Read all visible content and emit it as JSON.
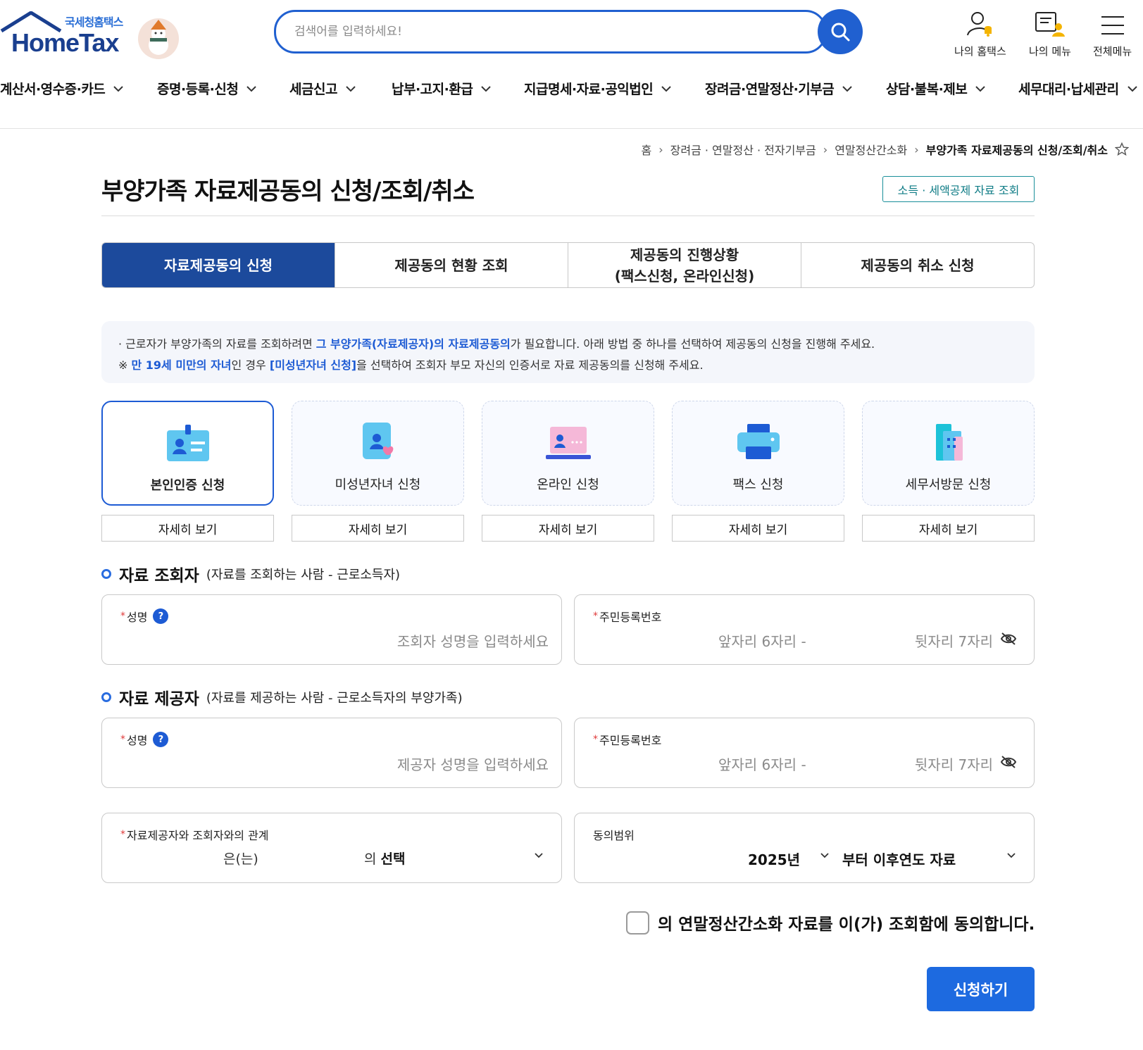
{
  "logo": {
    "sub": "국세청홈택스",
    "main": "HomeTax"
  },
  "search": {
    "placeholder": "검색어를 입력하세요!"
  },
  "util": {
    "my_hometax": "나의 홈택스",
    "my_menu": "나의 메뉴",
    "all_menu": "전체메뉴"
  },
  "gnb": [
    "계산서·영수증·카드",
    "증명·등록·신청",
    "세금신고",
    "납부·고지·환급",
    "지급명세·자료·공익법인",
    "장려금·연말정산·기부금",
    "상담·불복·제보",
    "세무대리·납세관리"
  ],
  "breadcrumb": {
    "home": "홈",
    "l1": "장려금 · 연말정산 · 전자기부금",
    "l2": "연말정산간소화",
    "current": "부양가족 자료제공동의 신청/조회/취소"
  },
  "page_title": "부양가족 자료제공동의 신청/조회/취소",
  "link_button": "소득 · 세액공제 자료 조회",
  "tabs": [
    {
      "line1": "자료제공동의 신청",
      "line2": ""
    },
    {
      "line1": "제공동의 현황 조회",
      "line2": ""
    },
    {
      "line1": "제공동의 진행상황",
      "line2": "(팩스신청, 온라인신청)"
    },
    {
      "line1": "제공동의 취소 신청",
      "line2": ""
    }
  ],
  "info": {
    "p1_a": "· 근로자가 부양가족의 자료를 조회하려면 ",
    "p1_hl": "그 부양가족(자료제공자)의 자료제공동의",
    "p1_b": "가 필요합니다. 아래 방법 중 하나를 선택하여 제공동의 신청을 진행해 주세요.",
    "p2_a": "※ ",
    "p2_hl1": "만 19세 미만의 자녀",
    "p2_b": "인 경우 ",
    "p2_hl2": "[미성년자녀 신청]",
    "p2_c": "을 선택하여 조회자 부모 자신의 인증서로 자료 제공동의를 신청해 주세요."
  },
  "methods": [
    {
      "label": "본인인증 신청",
      "icon": "id-card-icon",
      "selected": true
    },
    {
      "label": "미성년자녀 신청",
      "icon": "child-heart-icon",
      "selected": false
    },
    {
      "label": "온라인 신청",
      "icon": "laptop-icon",
      "selected": false
    },
    {
      "label": "팩스 신청",
      "icon": "printer-icon",
      "selected": false
    },
    {
      "label": "세무서방문 신청",
      "icon": "building-icon",
      "selected": false
    }
  ],
  "detail_label": "자세히 보기",
  "viewer": {
    "title": "자료 조회자",
    "desc": "(자료를 조회하는 사람 - 근로소득자)",
    "name_label": "성명",
    "name_placeholder": "조회자 성명을 입력하세요",
    "rrn_label": "주민등록번호",
    "rrn_front": "앞자리 6자리 -",
    "rrn_back": "뒷자리 7자리"
  },
  "provider": {
    "title": "자료 제공자",
    "desc": "(자료를 제공하는 사람 - 근로소득자의 부양가족)",
    "name_label": "성명",
    "name_placeholder": "제공자 성명을 입력하세요",
    "rrn_label": "주민등록번호",
    "rrn_front": "앞자리 6자리 -",
    "rrn_back": "뒷자리 7자리"
  },
  "relation": {
    "label": "자료제공자와 조회자와의 관계",
    "part_a": "은(는)",
    "part_b": "의",
    "select": "선택"
  },
  "scope": {
    "label": "동의범위",
    "year": "2025년",
    "suffix": "부터 이후연도 자료"
  },
  "agree_text": "의 연말정산간소화 자료를 이(가) 조회함에 동의합니다.",
  "submit": "신청하기",
  "colors": {
    "primary": "#1c4a9c",
    "accent": "#1d6ae0",
    "required": "#e03b3b"
  }
}
